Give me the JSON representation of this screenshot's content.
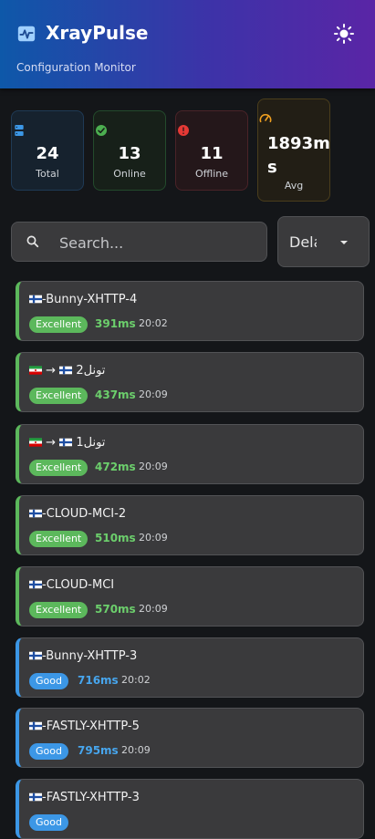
{
  "header": {
    "title": "XrayPulse",
    "subtitle": "Configuration Monitor",
    "colors": {
      "gradient_start": "#0e58a9",
      "gradient_end": "#5a25a6"
    }
  },
  "stats": {
    "total": {
      "value": "24",
      "label": "Total",
      "icon": "server-icon",
      "color": "#3c97e6"
    },
    "online": {
      "value": "13",
      "label": "Online",
      "icon": "check-circle-icon",
      "color": "#4caf50"
    },
    "offline": {
      "value": "11",
      "label": "Offline",
      "icon": "alert-circle-icon",
      "color": "#e53935"
    },
    "avg": {
      "value_line1": "1893m",
      "value_line2": "s",
      "label": "Avg",
      "icon": "speedometer-icon",
      "color": "#f0a020"
    }
  },
  "search": {
    "placeholder": "Search...",
    "value": ""
  },
  "sort": {
    "selected": "Delay"
  },
  "configs": [
    {
      "name": "-Bunny-XHTTP-4",
      "flags": [
        "fi"
      ],
      "status": "Excellent",
      "ping": "391ms",
      "time": "20:02"
    },
    {
      "name": "تونل2",
      "flags": [
        "ir",
        "fi"
      ],
      "arrow": "→",
      "status": "Excellent",
      "ping": "437ms",
      "time": "20:09"
    },
    {
      "name": "تونل1",
      "flags": [
        "ir",
        "fi"
      ],
      "arrow": "→",
      "status": "Excellent",
      "ping": "472ms",
      "time": "20:09"
    },
    {
      "name": "-CLOUD-MCI-2",
      "flags": [
        "fi"
      ],
      "status": "Excellent",
      "ping": "510ms",
      "time": "20:09"
    },
    {
      "name": "-CLOUD-MCI",
      "flags": [
        "fi"
      ],
      "status": "Excellent",
      "ping": "570ms",
      "time": "20:09"
    },
    {
      "name": "-Bunny-XHTTP-3",
      "flags": [
        "fi"
      ],
      "status": "Good",
      "ping": "716ms",
      "time": "20:02"
    },
    {
      "name": "-FASTLY-XHTTP-5",
      "flags": [
        "fi"
      ],
      "status": "Good",
      "ping": "795ms",
      "time": "20:09"
    },
    {
      "name": "-FASTLY-XHTTP-3",
      "flags": [
        "fi"
      ],
      "status": "Good",
      "ping": "",
      "time": ""
    }
  ],
  "status_colors": {
    "Excellent": "#5cb85c",
    "Good": "#3c97e6"
  }
}
